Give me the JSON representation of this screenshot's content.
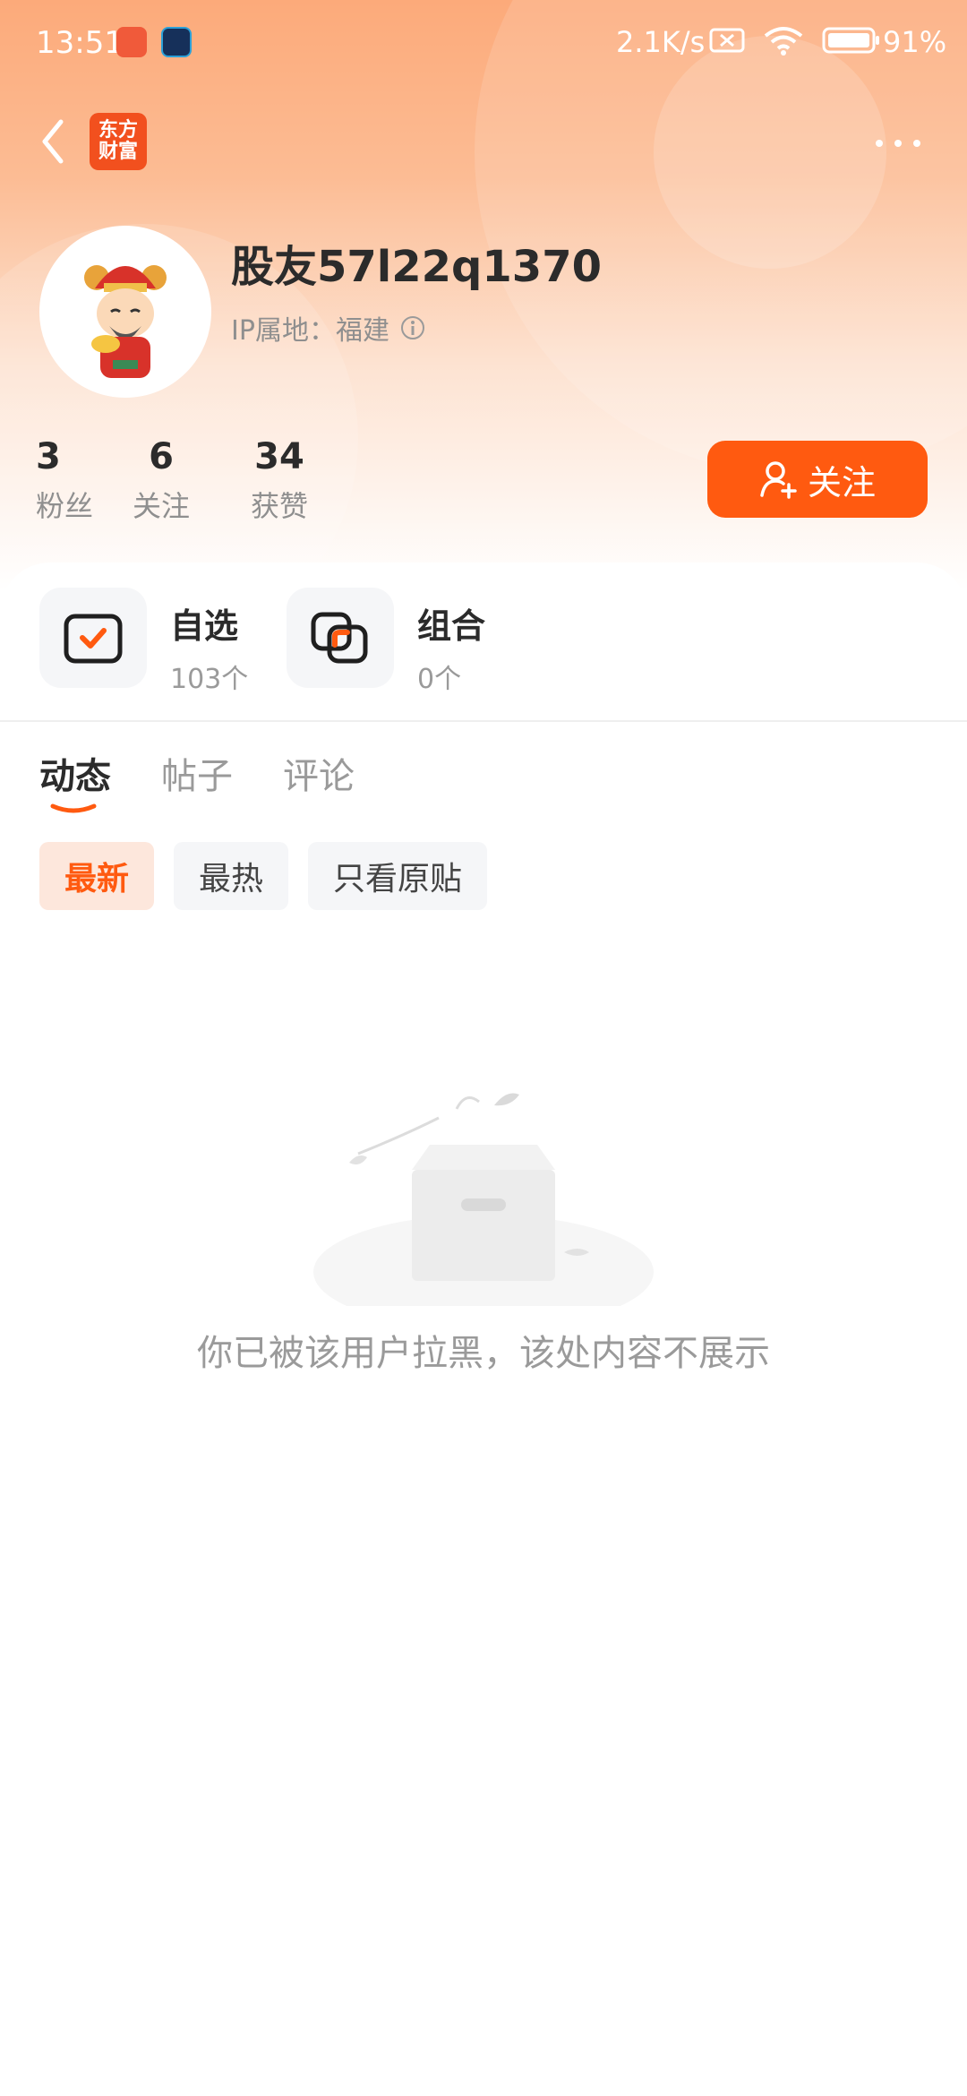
{
  "status_bar": {
    "time": "13:51",
    "network_speed": "2.1K/s",
    "battery": "91%"
  },
  "header": {
    "logo_text_line1": "东方",
    "logo_text_line2": "财富"
  },
  "profile": {
    "username": "股友57l22q1370",
    "ip_location": "IP属地：福建",
    "stats": [
      {
        "value": "3",
        "label": "粉丝"
      },
      {
        "value": "6",
        "label": "关注"
      },
      {
        "value": "34",
        "label": "获赞"
      }
    ],
    "follow_button": "关注"
  },
  "quick_links": [
    {
      "title": "自选",
      "subtitle": "103个",
      "icon": "watchlist-icon"
    },
    {
      "title": "组合",
      "subtitle": "0个",
      "icon": "portfolio-icon"
    }
  ],
  "tabs": [
    {
      "label": "动态",
      "active": true
    },
    {
      "label": "帖子",
      "active": false
    },
    {
      "label": "评论",
      "active": false
    }
  ],
  "filters": [
    {
      "label": "最新",
      "active": true
    },
    {
      "label": "最热",
      "active": false
    },
    {
      "label": "只看原贴",
      "active": false
    }
  ],
  "empty_state": {
    "message": "你已被该用户拉黑，该处内容不展示",
    "icon": "empty-box-icon"
  },
  "colors": {
    "accent": "#ff5a10",
    "header_gradient_top": "#fcaa7a"
  }
}
